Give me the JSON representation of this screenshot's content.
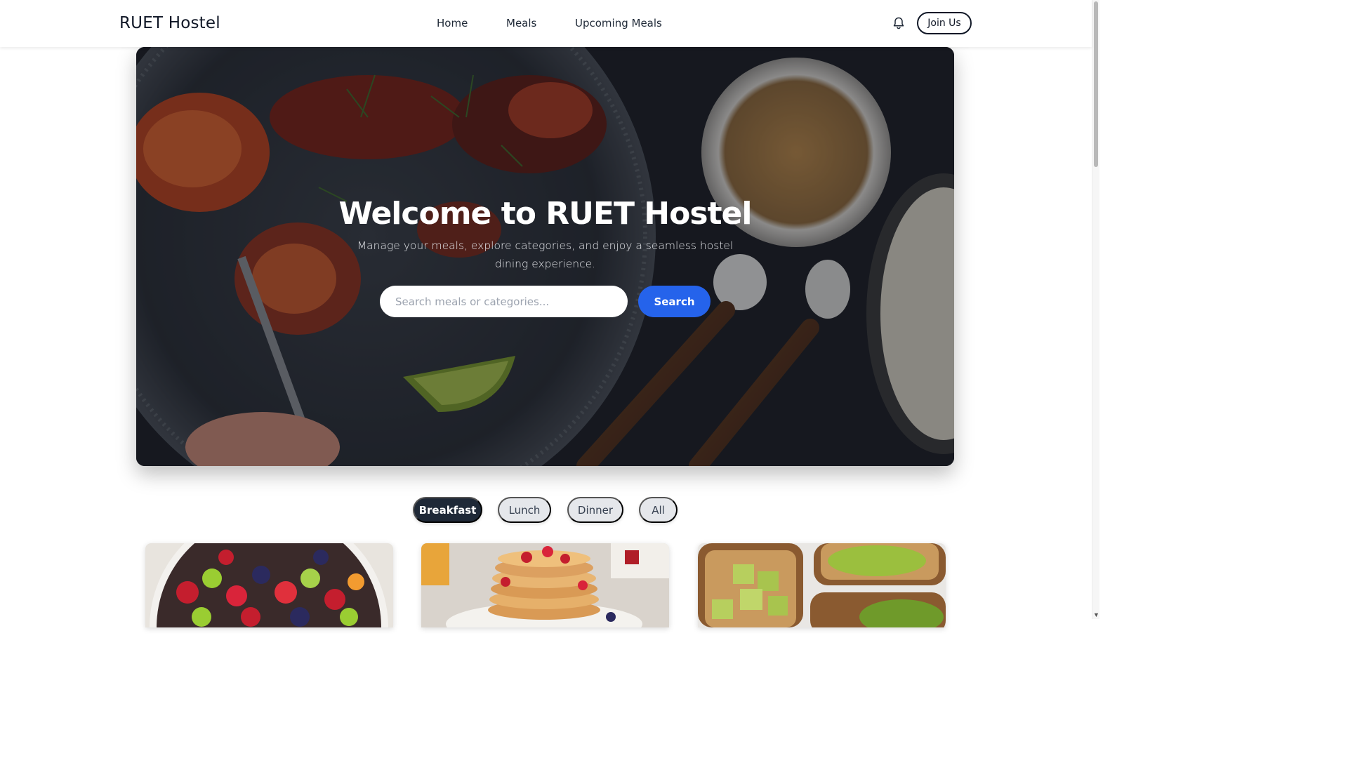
{
  "navbar": {
    "brand": "RUET Hostel",
    "links": [
      "Home",
      "Meals",
      "Upcoming Meals"
    ],
    "join_label": "Join Us"
  },
  "hero": {
    "title": "Welcome to RUET Hostel",
    "subtitle": "Manage your meals, explore categories, and enjoy a seamless hostel dining experience.",
    "search_placeholder": "Search meals or categories...",
    "search_label": "Search"
  },
  "tabs": [
    {
      "label": "Breakfast",
      "active": true
    },
    {
      "label": "Lunch",
      "active": false
    },
    {
      "label": "Dinner",
      "active": false
    },
    {
      "label": "All",
      "active": false
    }
  ],
  "cards": [
    {
      "image": "fruit-salad-image"
    },
    {
      "image": "pancakes-image"
    },
    {
      "image": "avocado-toast-image"
    }
  ],
  "colors": {
    "primary": "#2563eb",
    "active_tab": "#1f2937",
    "inactive_tab": "#e5e7eb"
  }
}
